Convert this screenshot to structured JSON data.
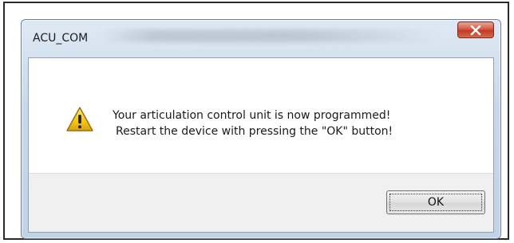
{
  "window": {
    "title": "ACU_COM",
    "close_icon": "close-x-icon"
  },
  "dialog": {
    "icon": "warning-icon",
    "message_line1": "Your articulation control unit is now programmed!",
    "message_line2": "Restart the device with pressing the \"OK\" button!",
    "ok_label": "OK"
  },
  "colors": {
    "close_button": "#c94a33",
    "warning_fill": "#f2c51d",
    "window_frame": "#c9d8e8"
  }
}
